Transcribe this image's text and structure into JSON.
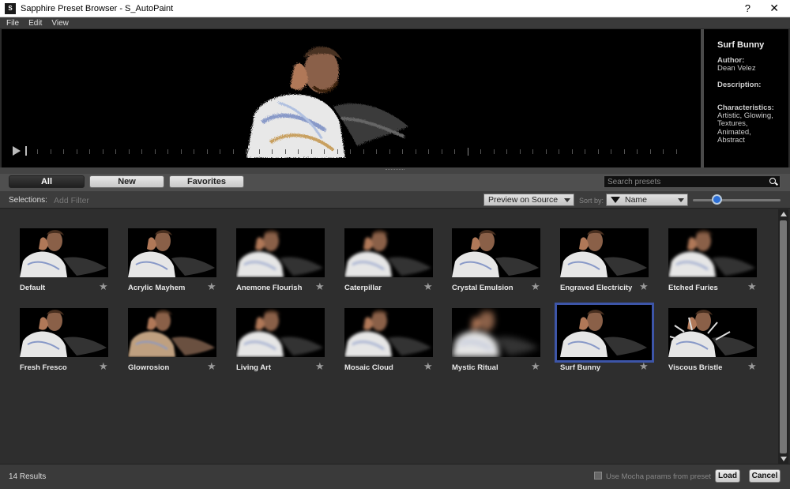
{
  "window": {
    "icon_label": "S",
    "title": "Sapphire Preset Browser - S_AutoPaint",
    "help": "?",
    "close": "✕"
  },
  "menu": [
    "File",
    "Edit",
    "View"
  ],
  "info": {
    "title": "Surf Bunny",
    "author_label": "Author:",
    "author": "Dean Velez",
    "description_label": "Description:",
    "characteristics_label": "Characteristics:",
    "characteristics": [
      "Artistic, Glowing,",
      "Textures,",
      "Animated,",
      "Abstract"
    ]
  },
  "tabs": [
    {
      "label": "All",
      "active": true
    },
    {
      "label": "New",
      "active": false
    },
    {
      "label": "Favorites",
      "active": false
    }
  ],
  "search": {
    "placeholder": "Search presets"
  },
  "selections": {
    "label": "Selections:",
    "add_filter": "Add Filter",
    "preview_mode": "Preview on Source",
    "sort_label": "Sort by:",
    "sort_value": "Name",
    "thumb_size_fraction": 0.27
  },
  "presets": [
    {
      "name": "Default",
      "style": "sharp"
    },
    {
      "name": "Acrylic Mayhem",
      "style": "sharp"
    },
    {
      "name": "Anemone Flourish",
      "style": "blurred"
    },
    {
      "name": "Caterpillar",
      "style": "blurred"
    },
    {
      "name": "Crystal Emulsion",
      "style": "sharp"
    },
    {
      "name": "Engraved Electricity",
      "style": "sharp"
    },
    {
      "name": "Etched Furies",
      "style": "blurred"
    },
    {
      "name": "Fresh Fresco",
      "style": "sharp"
    },
    {
      "name": "Glowrosion",
      "style": "glow"
    },
    {
      "name": "Living Art",
      "style": "blurred"
    },
    {
      "name": "Mosaic Cloud",
      "style": "blurred"
    },
    {
      "name": "Mystic Ritual",
      "style": "veryblurred"
    },
    {
      "name": "Surf Bunny",
      "style": "sharp",
      "selected": true
    },
    {
      "name": "Viscous Bristle",
      "style": "spiky"
    }
  ],
  "status": {
    "results": "14 Results",
    "mocha_label": "Use Mocha params from preset",
    "load": "Load",
    "cancel": "Cancel"
  },
  "colors": {
    "accent": "#2d6fd6",
    "selection_border": "#3d55a8",
    "background": "#2e2e2e"
  }
}
